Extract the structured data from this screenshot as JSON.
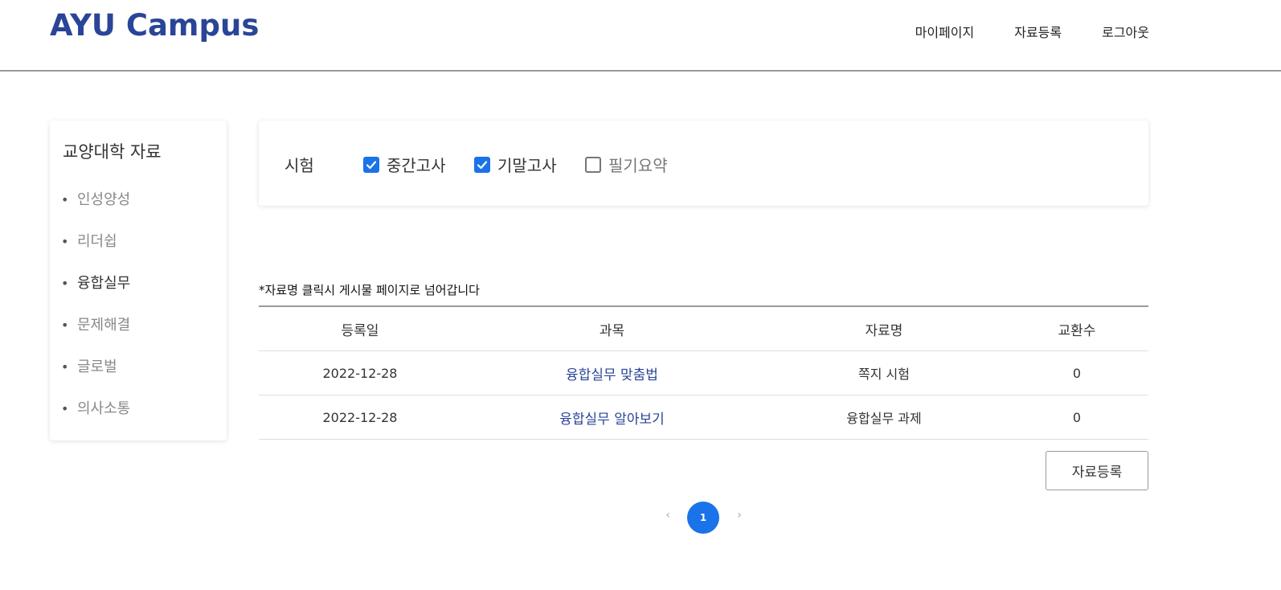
{
  "header": {
    "logo": "AYU Campus",
    "nav": [
      "마이페이지",
      "자료등록",
      "로그아웃"
    ]
  },
  "sidebar": {
    "title": "교양대학 자료",
    "items": [
      {
        "label": "인성양성",
        "active": false
      },
      {
        "label": "리더쉽",
        "active": false
      },
      {
        "label": "융합실무",
        "active": true
      },
      {
        "label": "문제해결",
        "active": false
      },
      {
        "label": "글로벌",
        "active": false
      },
      {
        "label": "의사소통",
        "active": false
      }
    ]
  },
  "filter": {
    "label": "시험",
    "options": [
      {
        "label": "중간고사",
        "checked": true
      },
      {
        "label": "기말고사",
        "checked": true
      },
      {
        "label": "필기요약",
        "checked": false
      }
    ]
  },
  "note": "*자료명 클릭시 게시물 페이지로 넘어갑니다",
  "table": {
    "headers": [
      "등록일",
      "과목",
      "자료명",
      "교환수"
    ],
    "rows": [
      {
        "date": "2022-12-28",
        "subject": "융합실무 맞춤법",
        "title": "쪽지 시험",
        "exchanges": "0"
      },
      {
        "date": "2022-12-28",
        "subject": "융합실무 알아보기",
        "title": "융합실무 과제",
        "exchanges": "0"
      }
    ]
  },
  "register_button": "자료등록",
  "pagination": {
    "prev": "‹",
    "current": "1",
    "next": "›"
  },
  "colors": {
    "brand": "#2a4597",
    "accent": "#1a73e8"
  }
}
